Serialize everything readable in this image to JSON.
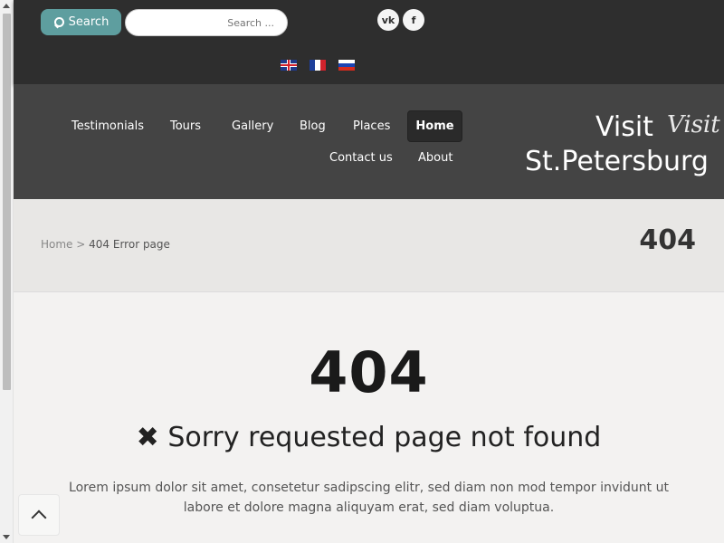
{
  "topbar": {
    "search_button_label": "Search",
    "search_placeholder": "Search ...",
    "social": {
      "vk": "vk",
      "facebook": "f"
    },
    "languages": [
      "English",
      "Français",
      "Русский"
    ]
  },
  "header": {
    "logo_script": "Visit",
    "logo_line1": "Visit",
    "logo_line2": "St.Petersburg",
    "nav": {
      "home": "Home",
      "places": "Places",
      "blog": "Blog",
      "gallery": "Gallery",
      "tours": "Tours",
      "testimonials": "Testimonials",
      "about": "About",
      "contact": "Contact us"
    }
  },
  "titlebar": {
    "title": "404",
    "breadcrumb_home": "Home",
    "breadcrumb_sep": ">",
    "breadcrumb_current": "404 Error page"
  },
  "content": {
    "code": "404",
    "heading": "✖ Sorry requested page not found",
    "body": "Lorem ipsum dolor sit amet, consetetur sadipscing elitr, sed diam non mod tempor invidunt ut labore et dolore magna aliquyam erat, sed diam voluptua."
  },
  "colors": {
    "topbar": "#2e2e2e",
    "header": "#444444",
    "accent": "#5e9e9f"
  }
}
